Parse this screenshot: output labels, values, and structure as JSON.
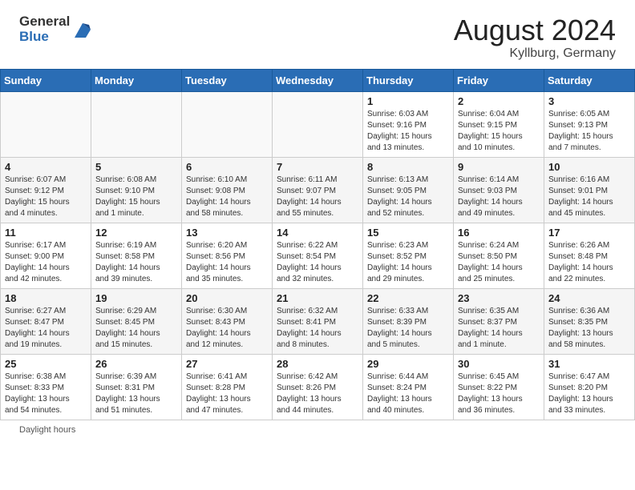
{
  "header": {
    "logo_general": "General",
    "logo_blue": "Blue",
    "month_year": "August 2024",
    "location": "Kyllburg, Germany"
  },
  "days_of_week": [
    "Sunday",
    "Monday",
    "Tuesday",
    "Wednesday",
    "Thursday",
    "Friday",
    "Saturday"
  ],
  "weeks": [
    [
      {
        "day": "",
        "info": ""
      },
      {
        "day": "",
        "info": ""
      },
      {
        "day": "",
        "info": ""
      },
      {
        "day": "",
        "info": ""
      },
      {
        "day": "1",
        "info": "Sunrise: 6:03 AM\nSunset: 9:16 PM\nDaylight: 15 hours\nand 13 minutes."
      },
      {
        "day": "2",
        "info": "Sunrise: 6:04 AM\nSunset: 9:15 PM\nDaylight: 15 hours\nand 10 minutes."
      },
      {
        "day": "3",
        "info": "Sunrise: 6:05 AM\nSunset: 9:13 PM\nDaylight: 15 hours\nand 7 minutes."
      }
    ],
    [
      {
        "day": "4",
        "info": "Sunrise: 6:07 AM\nSunset: 9:12 PM\nDaylight: 15 hours\nand 4 minutes."
      },
      {
        "day": "5",
        "info": "Sunrise: 6:08 AM\nSunset: 9:10 PM\nDaylight: 15 hours\nand 1 minute."
      },
      {
        "day": "6",
        "info": "Sunrise: 6:10 AM\nSunset: 9:08 PM\nDaylight: 14 hours\nand 58 minutes."
      },
      {
        "day": "7",
        "info": "Sunrise: 6:11 AM\nSunset: 9:07 PM\nDaylight: 14 hours\nand 55 minutes."
      },
      {
        "day": "8",
        "info": "Sunrise: 6:13 AM\nSunset: 9:05 PM\nDaylight: 14 hours\nand 52 minutes."
      },
      {
        "day": "9",
        "info": "Sunrise: 6:14 AM\nSunset: 9:03 PM\nDaylight: 14 hours\nand 49 minutes."
      },
      {
        "day": "10",
        "info": "Sunrise: 6:16 AM\nSunset: 9:01 PM\nDaylight: 14 hours\nand 45 minutes."
      }
    ],
    [
      {
        "day": "11",
        "info": "Sunrise: 6:17 AM\nSunset: 9:00 PM\nDaylight: 14 hours\nand 42 minutes."
      },
      {
        "day": "12",
        "info": "Sunrise: 6:19 AM\nSunset: 8:58 PM\nDaylight: 14 hours\nand 39 minutes."
      },
      {
        "day": "13",
        "info": "Sunrise: 6:20 AM\nSunset: 8:56 PM\nDaylight: 14 hours\nand 35 minutes."
      },
      {
        "day": "14",
        "info": "Sunrise: 6:22 AM\nSunset: 8:54 PM\nDaylight: 14 hours\nand 32 minutes."
      },
      {
        "day": "15",
        "info": "Sunrise: 6:23 AM\nSunset: 8:52 PM\nDaylight: 14 hours\nand 29 minutes."
      },
      {
        "day": "16",
        "info": "Sunrise: 6:24 AM\nSunset: 8:50 PM\nDaylight: 14 hours\nand 25 minutes."
      },
      {
        "day": "17",
        "info": "Sunrise: 6:26 AM\nSunset: 8:48 PM\nDaylight: 14 hours\nand 22 minutes."
      }
    ],
    [
      {
        "day": "18",
        "info": "Sunrise: 6:27 AM\nSunset: 8:47 PM\nDaylight: 14 hours\nand 19 minutes."
      },
      {
        "day": "19",
        "info": "Sunrise: 6:29 AM\nSunset: 8:45 PM\nDaylight: 14 hours\nand 15 minutes."
      },
      {
        "day": "20",
        "info": "Sunrise: 6:30 AM\nSunset: 8:43 PM\nDaylight: 14 hours\nand 12 minutes."
      },
      {
        "day": "21",
        "info": "Sunrise: 6:32 AM\nSunset: 8:41 PM\nDaylight: 14 hours\nand 8 minutes."
      },
      {
        "day": "22",
        "info": "Sunrise: 6:33 AM\nSunset: 8:39 PM\nDaylight: 14 hours\nand 5 minutes."
      },
      {
        "day": "23",
        "info": "Sunrise: 6:35 AM\nSunset: 8:37 PM\nDaylight: 14 hours\nand 1 minute."
      },
      {
        "day": "24",
        "info": "Sunrise: 6:36 AM\nSunset: 8:35 PM\nDaylight: 13 hours\nand 58 minutes."
      }
    ],
    [
      {
        "day": "25",
        "info": "Sunrise: 6:38 AM\nSunset: 8:33 PM\nDaylight: 13 hours\nand 54 minutes."
      },
      {
        "day": "26",
        "info": "Sunrise: 6:39 AM\nSunset: 8:31 PM\nDaylight: 13 hours\nand 51 minutes."
      },
      {
        "day": "27",
        "info": "Sunrise: 6:41 AM\nSunset: 8:28 PM\nDaylight: 13 hours\nand 47 minutes."
      },
      {
        "day": "28",
        "info": "Sunrise: 6:42 AM\nSunset: 8:26 PM\nDaylight: 13 hours\nand 44 minutes."
      },
      {
        "day": "29",
        "info": "Sunrise: 6:44 AM\nSunset: 8:24 PM\nDaylight: 13 hours\nand 40 minutes."
      },
      {
        "day": "30",
        "info": "Sunrise: 6:45 AM\nSunset: 8:22 PM\nDaylight: 13 hours\nand 36 minutes."
      },
      {
        "day": "31",
        "info": "Sunrise: 6:47 AM\nSunset: 8:20 PM\nDaylight: 13 hours\nand 33 minutes."
      }
    ]
  ],
  "footer": {
    "note": "Daylight hours"
  }
}
